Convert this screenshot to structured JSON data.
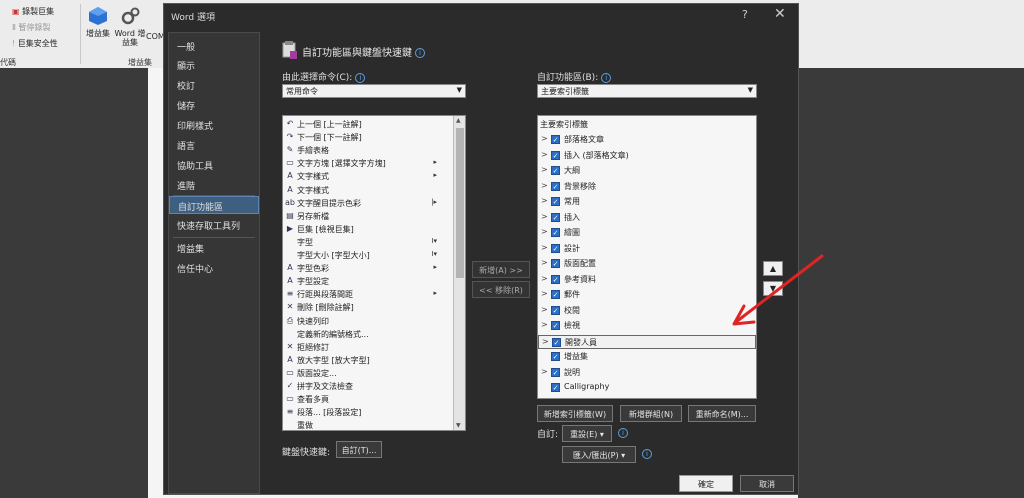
{
  "ribbon": {
    "record_macro": "錄製巨集",
    "pause_recording": "暫停錄製",
    "macro_security": "巨集安全性",
    "group_code": "代碼",
    "addins_label": "增益集",
    "word_addins_label": "Word 增益集",
    "com_label": "COM",
    "group_addins": "增益集"
  },
  "dialog": {
    "title": "Word 選項",
    "help": "?",
    "close": "✕"
  },
  "sidebar": {
    "items": [
      {
        "label": "一般"
      },
      {
        "label": "顯示"
      },
      {
        "label": "校訂"
      },
      {
        "label": "儲存"
      },
      {
        "label": "印刷樣式"
      },
      {
        "label": "語言"
      },
      {
        "label": "協助工具"
      },
      {
        "label": "進階"
      },
      {
        "label": "自訂功能區"
      },
      {
        "label": "快速存取工具列"
      },
      {
        "label": "增益集"
      },
      {
        "label": "信任中心"
      }
    ],
    "selected": "自訂功能區"
  },
  "main": {
    "heading": "自訂功能區與鍵盤快速鍵",
    "choose_label": "由此選擇命令(C):",
    "choose_value": "常用命令",
    "customize_label": "自訂功能區(B):",
    "customize_value": "主要索引標籤",
    "commands": [
      {
        "icon": "↶",
        "label": "上一個 [上一註解]",
        "sub": ""
      },
      {
        "icon": "↷",
        "label": "下一個 [下一註解]",
        "sub": ""
      },
      {
        "icon": "✎",
        "label": "手繪表格",
        "sub": ""
      },
      {
        "icon": "▭",
        "label": "文字方塊 [選擇文字方塊]",
        "sub": "▸"
      },
      {
        "icon": "A",
        "label": "文字樣式",
        "sub": "▸"
      },
      {
        "icon": "A",
        "label": "文字樣式",
        "sub": ""
      },
      {
        "icon": "ab",
        "label": "文字醒目提示色彩",
        "sub": "|▸"
      },
      {
        "icon": "▤",
        "label": "另存新檔",
        "sub": ""
      },
      {
        "icon": "▶",
        "label": "巨集 [檢視巨集]",
        "sub": ""
      },
      {
        "icon": "",
        "label": "字型",
        "sub": "I▾"
      },
      {
        "icon": "",
        "label": "字型大小 [字型大小]",
        "sub": "I▾"
      },
      {
        "icon": "A",
        "label": "字型色彩",
        "sub": "▸"
      },
      {
        "icon": "A",
        "label": "字型設定",
        "sub": ""
      },
      {
        "icon": "≡",
        "label": "行距與段落間距",
        "sub": "▸"
      },
      {
        "icon": "✕",
        "label": "刪除 [刪除註解]",
        "sub": ""
      },
      {
        "icon": "⎙",
        "label": "快速列印",
        "sub": ""
      },
      {
        "icon": "",
        "label": "定義新的編號格式...",
        "sub": ""
      },
      {
        "icon": "✕",
        "label": "拒絕修訂",
        "sub": ""
      },
      {
        "icon": "A",
        "label": "放大字型 [放大字型]",
        "sub": ""
      },
      {
        "icon": "▭",
        "label": "版面設定...",
        "sub": ""
      },
      {
        "icon": "✓",
        "label": "拼字及文法檢查",
        "sub": ""
      },
      {
        "icon": "▭",
        "label": "查看多頁",
        "sub": ""
      },
      {
        "icon": "≡",
        "label": "段落... [段落設定]",
        "sub": ""
      },
      {
        "icon": "",
        "label": "重做",
        "sub": ""
      }
    ],
    "add_button": "新增(A) >>",
    "remove_button": "<< 移除(R)",
    "tabs_header": "主要索引標籤",
    "tabs": [
      {
        "label": "部落格文章",
        "expand": true
      },
      {
        "label": "插入 (部落格文章)",
        "expand": true
      },
      {
        "label": "大綱",
        "expand": true
      },
      {
        "label": "背景移除",
        "expand": true
      },
      {
        "label": "常用",
        "expand": true
      },
      {
        "label": "插入",
        "expand": true
      },
      {
        "label": "繪圖",
        "expand": true
      },
      {
        "label": "設計",
        "expand": true
      },
      {
        "label": "版面配置",
        "expand": true
      },
      {
        "label": "參考資料",
        "expand": true
      },
      {
        "label": "郵件",
        "expand": true
      },
      {
        "label": "校閱",
        "expand": true
      },
      {
        "label": "檢視",
        "expand": true
      },
      {
        "label": "開發人員",
        "expand": true
      },
      {
        "label": "增益集",
        "expand": false
      },
      {
        "label": "說明",
        "expand": true
      },
      {
        "label": "Calligraphy",
        "expand": false
      }
    ],
    "highlighted_tab": "開發人員",
    "move_up": "▲",
    "move_down": "▼",
    "new_tab_button": "新增索引標籤(W)",
    "new_group_button": "新增群組(N)",
    "rename_button": "重新命名(M)...",
    "customize_label2": "自訂:",
    "reset_button": "重設(E) ▾",
    "import_export_button": "匯入/匯出(P) ▾",
    "keyboard_label": "鍵盤快速鍵:",
    "keyboard_button": "自訂(T)...",
    "ok_button": "確定",
    "cancel_button": "取消"
  },
  "annotation": {
    "color": "#e02424"
  }
}
